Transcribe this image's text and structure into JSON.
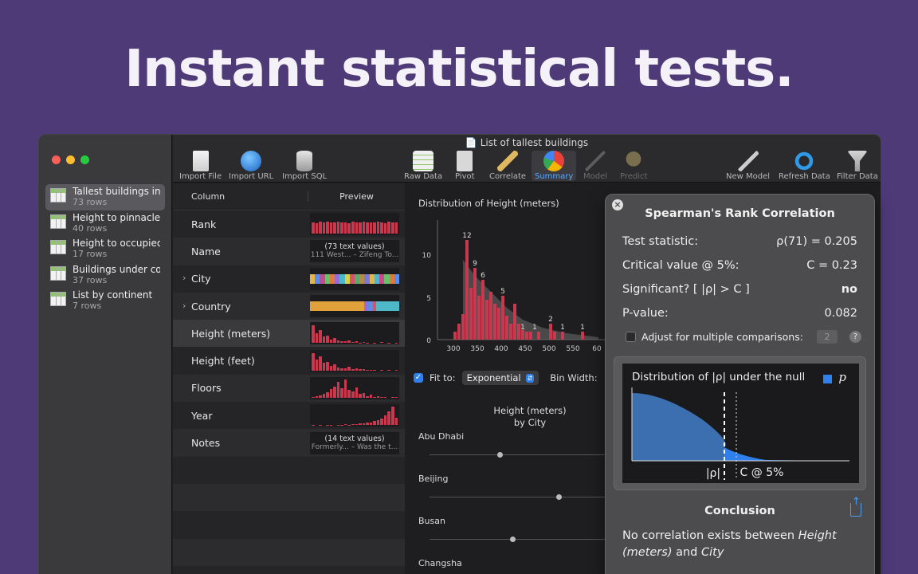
{
  "headline": "Instant statistical tests.",
  "window": {
    "title": "List of tallest buildings"
  },
  "sidebar": {
    "items": [
      {
        "title": "Tallest buildings in...",
        "rows": "73 rows"
      },
      {
        "title": "Height to pinnacle...",
        "rows": "40 rows"
      },
      {
        "title": "Height to occupied...",
        "rows": "17 rows"
      },
      {
        "title": "Buildings under co...",
        "rows": "37 rows"
      },
      {
        "title": "List by continent",
        "rows": "7 rows"
      }
    ]
  },
  "toolbar": {
    "import_file": "Import File",
    "import_url": "Import URL",
    "import_sql": "Import SQL",
    "raw_data": "Raw Data",
    "pivot": "Pivot",
    "correlate": "Correlate",
    "summary": "Summary",
    "model": "Model",
    "predict": "Predict",
    "new_model": "New Model",
    "refresh_data": "Refresh Data",
    "filter_data": "Filter Data"
  },
  "columns": {
    "header_column": "Column",
    "header_preview": "Preview",
    "rows": [
      {
        "name": "Rank"
      },
      {
        "name": "Name",
        "preview_l1": "(73 text values)",
        "preview_l2": "111 West... – Zifeng To..."
      },
      {
        "name": "City"
      },
      {
        "name": "Country"
      },
      {
        "name": "Height (meters)"
      },
      {
        "name": "Height (feet)"
      },
      {
        "name": "Floors"
      },
      {
        "name": "Year"
      },
      {
        "name": "Notes",
        "preview_l1": "(14 text values)",
        "preview_l2": "Formerly... – Was the t..."
      }
    ]
  },
  "distribution": {
    "title": "Distribution of Height (meters)",
    "y_ticks": [
      "10",
      "5",
      "0"
    ],
    "x_ticks": [
      "300",
      "350",
      "400",
      "450",
      "500",
      "550",
      "60"
    ],
    "bar_labels": [
      "12",
      "9",
      "6",
      "5",
      "1",
      "1",
      "2",
      "1",
      "1"
    ]
  },
  "fit": {
    "label": "Fit to:",
    "value": "Exponential",
    "bin_width_label": "Bin Width:"
  },
  "city_plot": {
    "title_l1": "Height (meters)",
    "title_l2": "by City",
    "cities": [
      "Abu Dhabi",
      "Beijing",
      "Busan",
      "Changsha"
    ]
  },
  "test": {
    "title": "Spearman's Rank Correlation",
    "stat_label": "Test statistic:",
    "stat_value": "ρ(71) = 0.205",
    "critical_label": "Critical value @ 5%:",
    "critical_value": "C = 0.23",
    "significant_label": "Significant? [ |ρ| > C ]",
    "significant_value": "no",
    "pvalue_label": "P-value:",
    "pvalue_value": "0.082",
    "adjust_label": "Adjust for multiple comparisons:",
    "adjust_value": "2",
    "null_title": "Distribution of |ρ| under the null",
    "legend_symbol": "p",
    "rho_marker": "|ρ|",
    "c_marker": "C @ 5%",
    "conclusion_title": "Conclusion",
    "conclusion_text_1": "No correlation exists between ",
    "conclusion_var1": "Height (meters)",
    "conclusion_and": " and ",
    "conclusion_var2": "City"
  },
  "colors": {
    "background": "#4f3a78",
    "accent": "#2f80ed",
    "bar": "#c8394f"
  }
}
